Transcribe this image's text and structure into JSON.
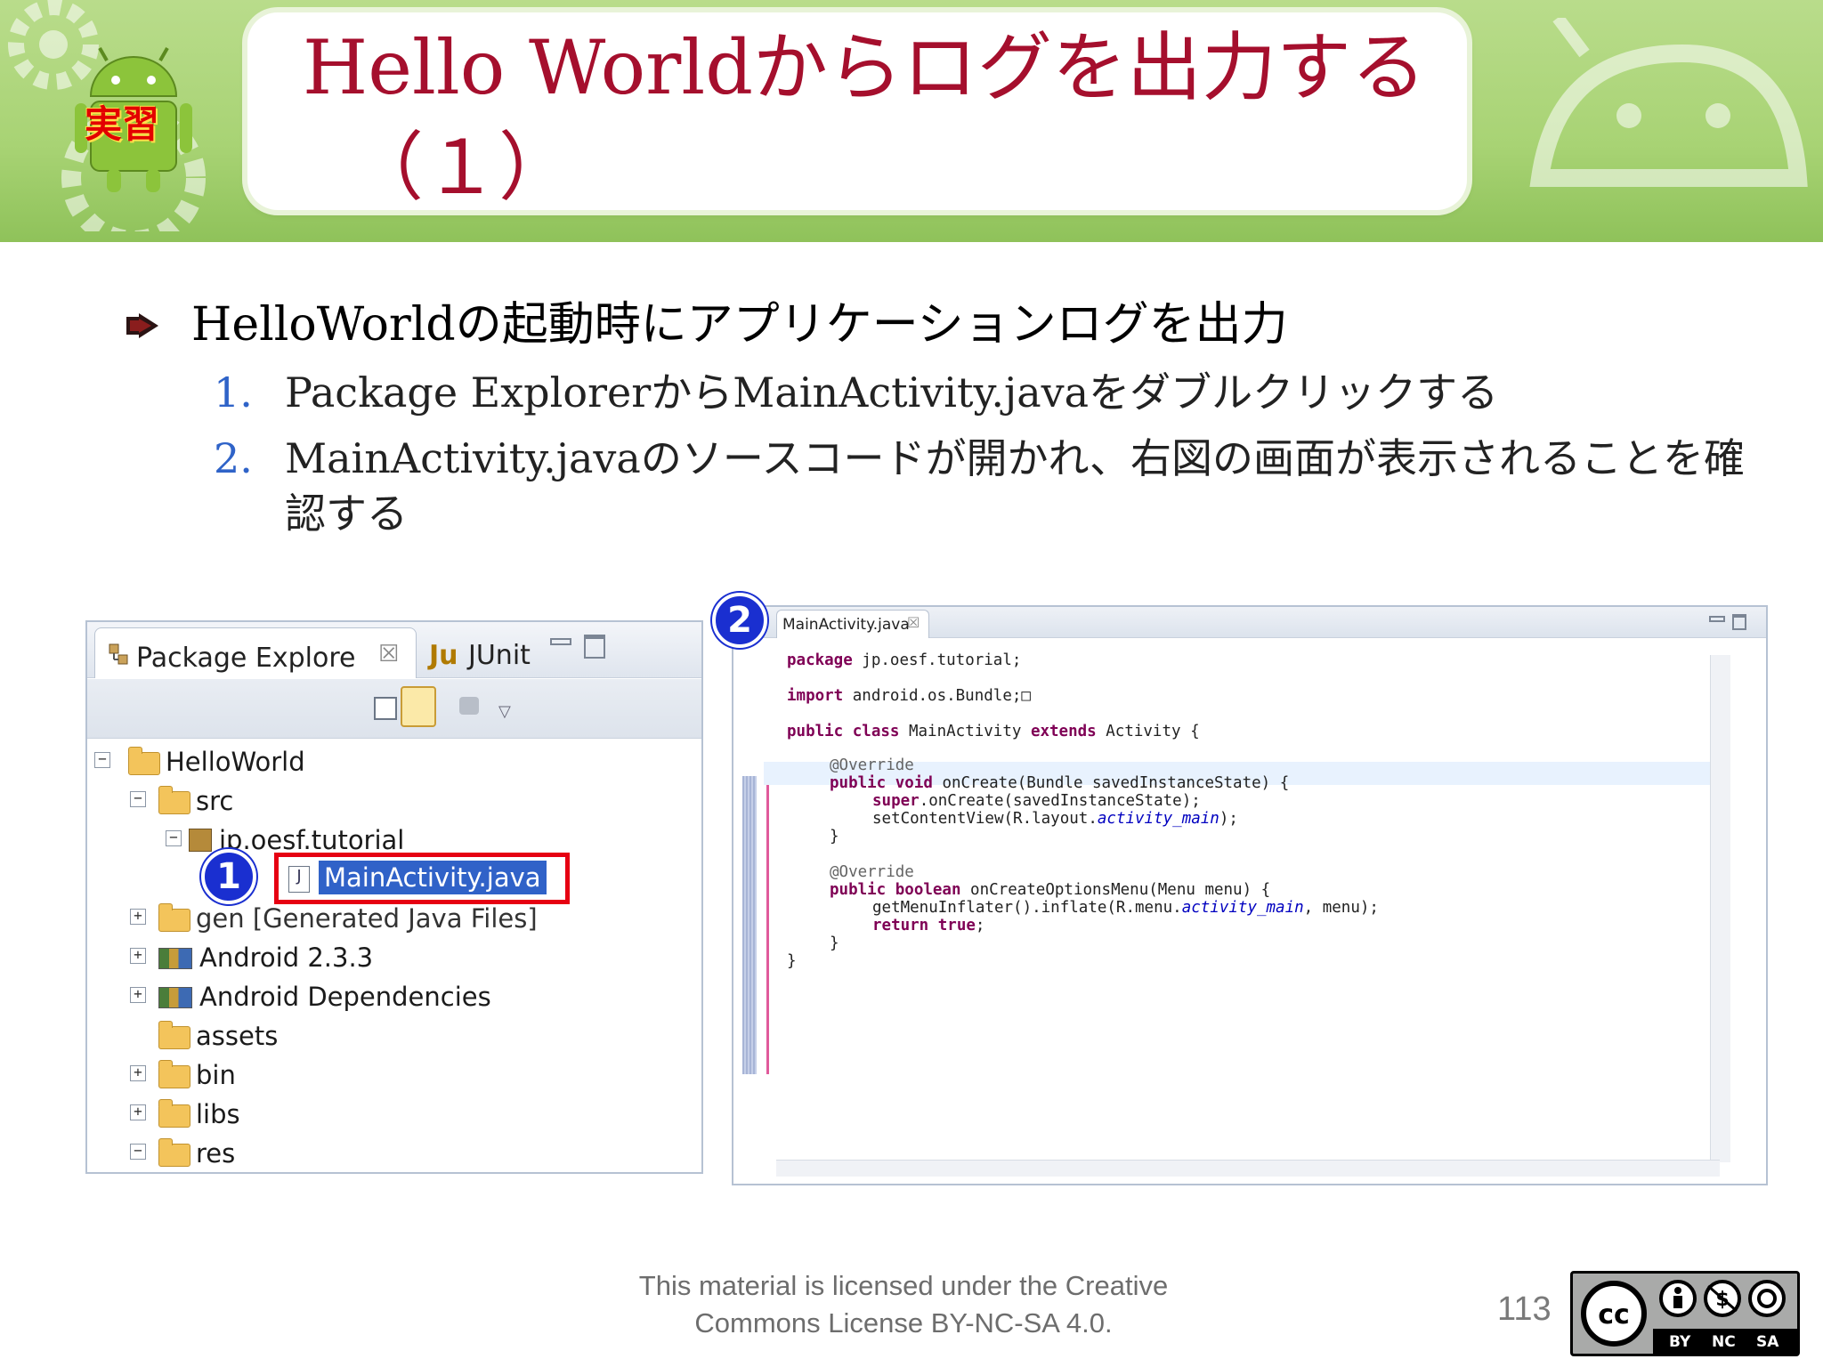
{
  "slide": {
    "title_line1": "Hello Worldからログを出力する",
    "title_line2": "（１）",
    "badge": "実習",
    "bullet": "HelloWorldの起動時にアプリケーションログを出力",
    "steps": [
      {
        "num": "1.",
        "text": "Package ExplorerからMainActivity.javaをダブルクリックする"
      },
      {
        "num": "2.",
        "text": "MainActivity.javaのソースコードが開かれ、右図の画面が表示されることを確認する"
      }
    ],
    "colors": {
      "title": "#a50f2d",
      "step_number": "#2f63c8",
      "banner": "#a8d374",
      "marker": "#1a2fd0",
      "highlight_box": "#e60012"
    }
  },
  "package_explorer": {
    "tab_label": "Package Explore",
    "tab2_label": "JUnit",
    "tree": [
      {
        "label": "HelloWorld",
        "icon": "project-icon"
      },
      {
        "label": "src",
        "icon": "source-folder-icon"
      },
      {
        "label": "jp.oesf.tutorial",
        "icon": "package-icon"
      },
      {
        "label": "MainActivity.java",
        "icon": "java-file-icon"
      },
      {
        "label": "gen [Generated Java Files]",
        "icon": "source-folder-icon"
      },
      {
        "label": "Android 2.3.3",
        "icon": "library-icon"
      },
      {
        "label": "Android Dependencies",
        "icon": "library-icon"
      },
      {
        "label": "assets",
        "icon": "folder-icon"
      },
      {
        "label": "bin",
        "icon": "folder-icon"
      },
      {
        "label": "libs",
        "icon": "folder-icon"
      },
      {
        "label": "res",
        "icon": "folder-icon"
      }
    ],
    "marker": "1"
  },
  "editor": {
    "tab_label": "MainActivity.java",
    "marker": "2",
    "code": [
      {
        "k": "package",
        "r": " jp.oesf.tutorial;"
      },
      {
        "k": "import",
        "r": " android.os.Bundle;□"
      },
      {
        "k": "public class",
        "r": " MainActivity ",
        "k2": "extends",
        "r2": " Activity {"
      },
      {
        "a": "@Override"
      },
      {
        "k": "public void",
        "r": " onCreate(Bundle savedInstanceState) {"
      },
      {
        "k": "super",
        "r": ".onCreate(savedInstanceState);"
      },
      {
        "r": "setContentView(R.layout.",
        "i": "activity_main",
        "r2": ");"
      },
      {
        "r": "}"
      },
      {
        "a": "@Override"
      },
      {
        "k": "public boolean",
        "r": " onCreateOptionsMenu(Menu menu) {"
      },
      {
        "r": "getMenuInflater().inflate(R.menu.",
        "i": "activity_main",
        "r2": ", menu);"
      },
      {
        "k": "return true",
        "r": ";"
      },
      {
        "r": "}"
      },
      {
        "r": "}"
      }
    ]
  },
  "footer": {
    "license_line1": "This material is licensed under the Creative",
    "license_line2": "Commons License BY-NC-SA 4.0.",
    "page_number": "113",
    "cc_labels": [
      "BY",
      "NC",
      "SA"
    ]
  }
}
